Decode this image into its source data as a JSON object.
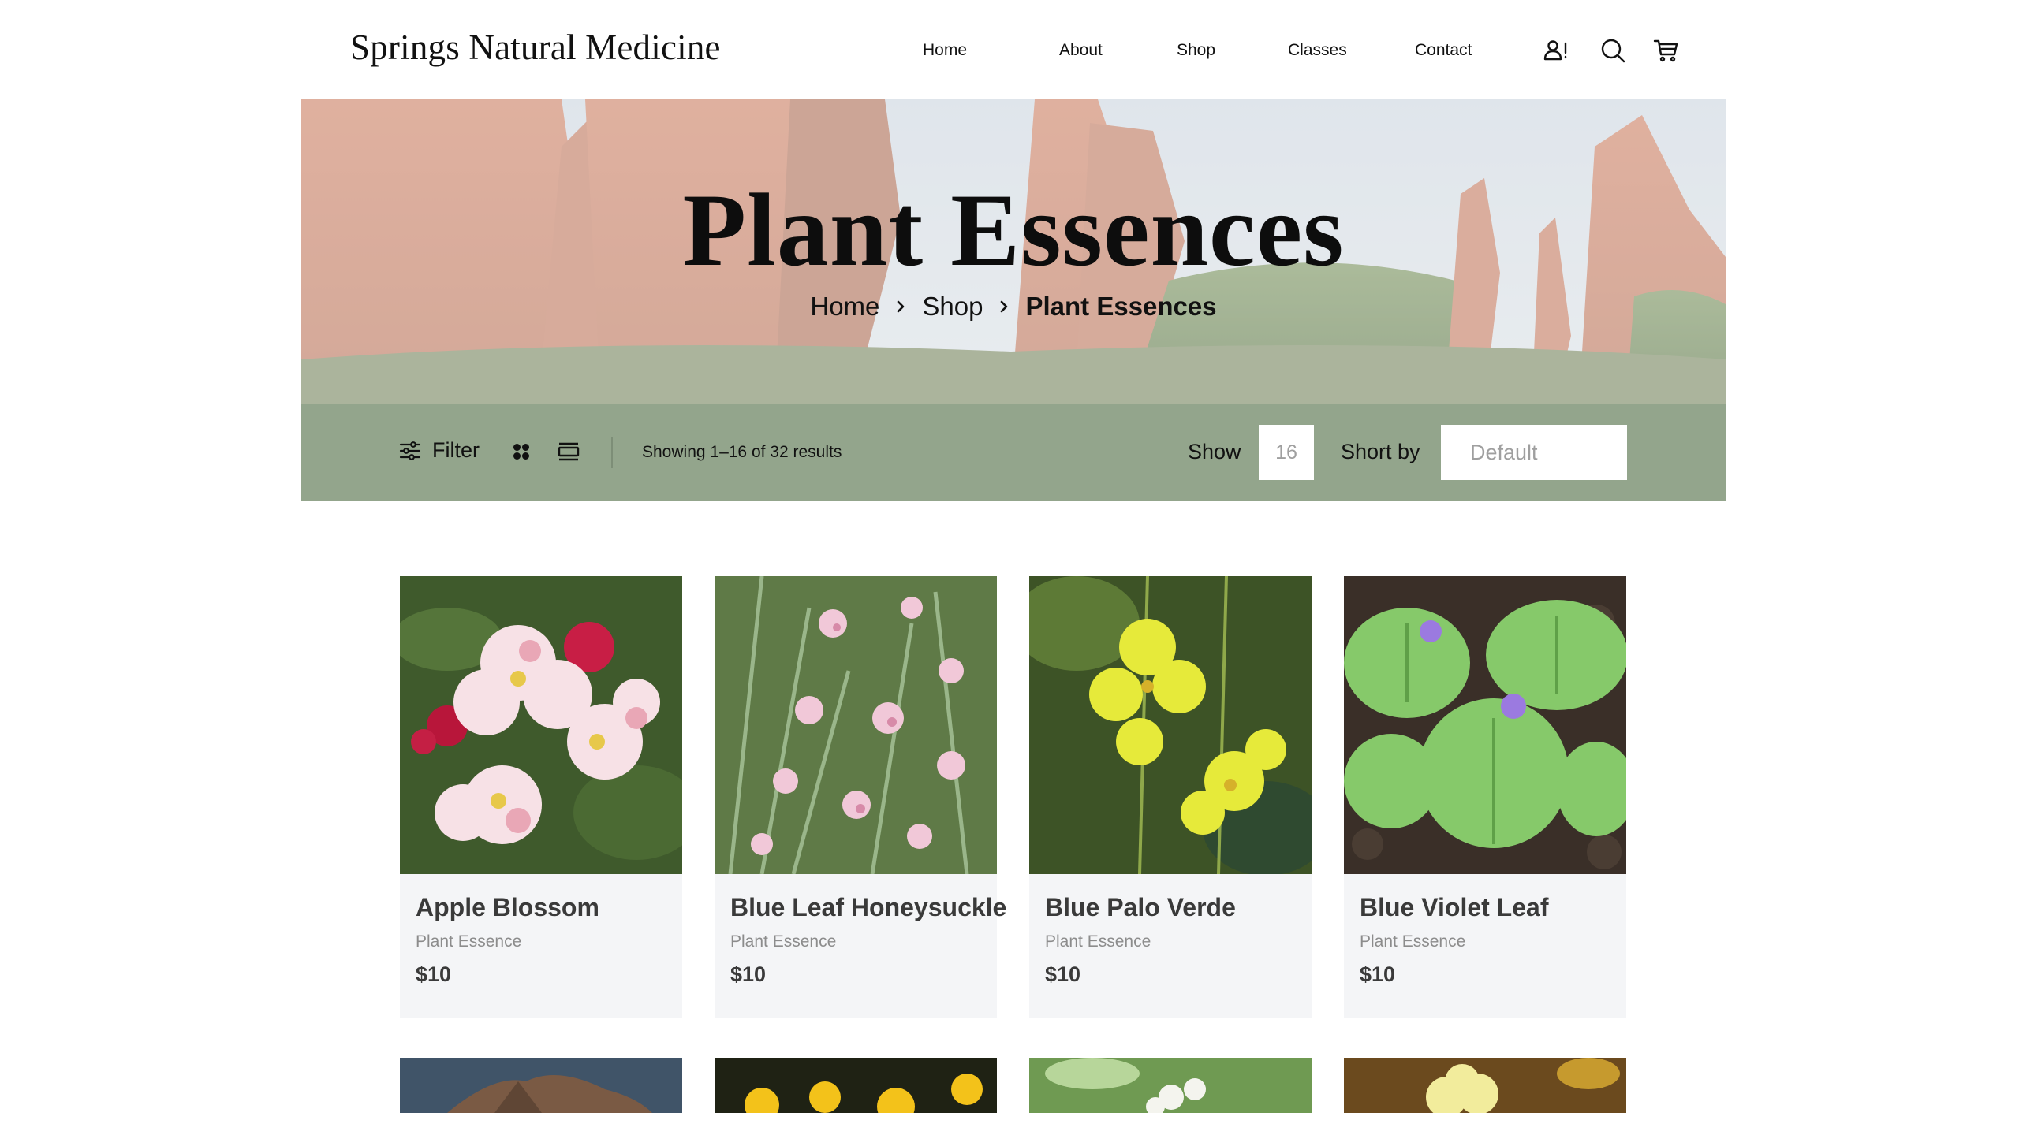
{
  "site": {
    "brand": "Springs Natural Medicine",
    "nav": [
      {
        "label": "Home"
      },
      {
        "label": "About"
      },
      {
        "label": "Shop"
      },
      {
        "label": "Classes"
      },
      {
        "label": "Contact"
      }
    ],
    "icons": [
      "account-alert-icon",
      "search-icon",
      "cart-icon"
    ]
  },
  "hero": {
    "title": "Plant Essences",
    "breadcrumb": {
      "home": "Home",
      "shop": "Shop",
      "current": "Plant Essences"
    }
  },
  "toolbar": {
    "filter_label": "Filter",
    "results_text": "Showing 1–16 of 32 results",
    "show_label": "Show",
    "show_value": "16",
    "sort_label": "Short by",
    "sort_value": "Default"
  },
  "products": [
    {
      "name": "Apple Blossom",
      "category": "Plant Essence",
      "price": "$10"
    },
    {
      "name": "Blue Leaf Honeysuckle",
      "category": "Plant Essence",
      "price": "$10"
    },
    {
      "name": "Blue Palo Verde",
      "category": "Plant Essence",
      "price": "$10"
    },
    {
      "name": "Blue Violet Leaf",
      "category": "Plant Essence",
      "price": "$10"
    }
  ],
  "colors": {
    "toolbar_bg": "#93a58c",
    "card_bg": "#f4f5f7",
    "text_dark": "#111111",
    "text_muted": "#8c8c8c"
  }
}
